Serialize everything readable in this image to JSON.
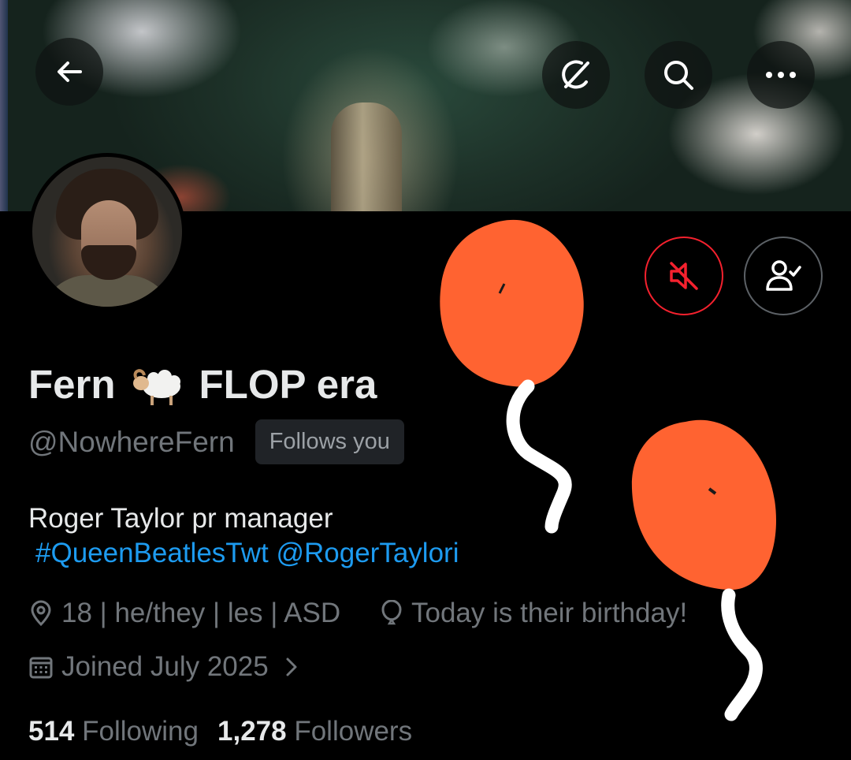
{
  "header": {
    "back_icon": "arrow-left-icon",
    "grok_icon": "grok-icon",
    "search_icon": "search-icon",
    "more_icon": "more-horizontal-icon"
  },
  "profile": {
    "display_name_prefix": "Fern",
    "display_name_emoji": "ram-emoji",
    "display_name_suffix": "FLOP era",
    "handle": "@NowhereFern",
    "follows_you": "Follows you",
    "bio_text": "Roger Taylor pr manager",
    "bio_hashtag": "#QueenBeatlesTwt",
    "bio_mention": "@RogerTaylori",
    "location": "18 | he/they | les | ASD",
    "birthday": "Today is their birthday!",
    "joined": "Joined July 2025",
    "following_count": "514",
    "following_label": "Following",
    "followers_count": "1,278",
    "followers_label": "Followers"
  },
  "actions": {
    "mute_icon": "muted-speaker-icon",
    "follow_icon": "person-check-icon"
  },
  "colors": {
    "background": "#000000",
    "text": "#e7e9ea",
    "secondary": "#71767b",
    "link": "#1d9bf0",
    "mute_red": "#f4212e",
    "balloon": "#ff6331"
  }
}
